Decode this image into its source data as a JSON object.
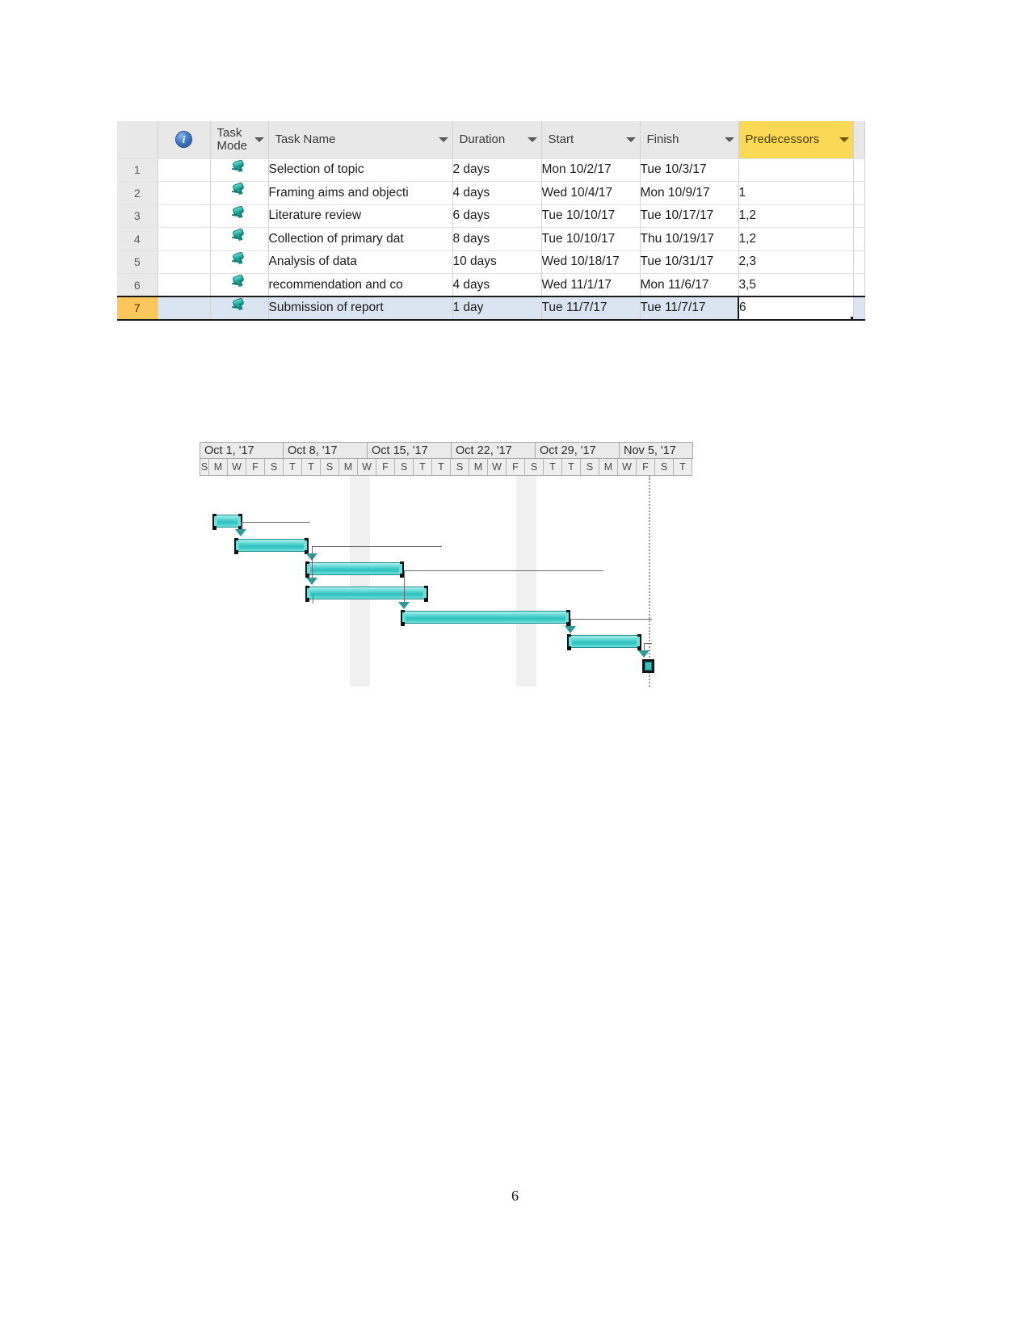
{
  "document": {
    "page_number": "6"
  },
  "task_table": {
    "columns": [
      {
        "key": "rownum",
        "label": "",
        "sortable": false
      },
      {
        "key": "ind",
        "label": "",
        "icon": "info-icon",
        "sortable": false
      },
      {
        "key": "mode",
        "label": "Task Mode",
        "sortable": true
      },
      {
        "key": "name",
        "label": "Task Name",
        "sortable": true
      },
      {
        "key": "dur",
        "label": "Duration",
        "sortable": true
      },
      {
        "key": "start",
        "label": "Start",
        "sortable": true
      },
      {
        "key": "finish",
        "label": "Finish",
        "sortable": true
      },
      {
        "key": "pred",
        "label": "Predecessors",
        "sortable": true,
        "highlight": true
      }
    ],
    "header_labels": {
      "task_mode": "Task Mode",
      "task_name": "Task Name",
      "duration": "Duration",
      "start": "Start",
      "finish": "Finish",
      "predecessors": "Predecessors"
    },
    "rows": [
      {
        "num": "1",
        "mode_icon": "pushpin-icon",
        "name": "Selection of topic",
        "duration": "2 days",
        "start": "Mon 10/2/17",
        "finish": "Tue 10/3/17",
        "predecessors": ""
      },
      {
        "num": "2",
        "mode_icon": "pushpin-icon",
        "name": "Framing aims and objecti",
        "duration": "4 days",
        "start": "Wed 10/4/17",
        "finish": "Mon 10/9/17",
        "predecessors": "1"
      },
      {
        "num": "3",
        "mode_icon": "pushpin-icon",
        "name": "Literature review",
        "duration": "6 days",
        "start": "Tue 10/10/17",
        "finish": "Tue 10/17/17",
        "predecessors": "1,2"
      },
      {
        "num": "4",
        "mode_icon": "pushpin-icon",
        "name": "Collection of primary dat",
        "duration": "8 days",
        "start": "Tue 10/10/17",
        "finish": "Thu 10/19/17",
        "predecessors": "1,2"
      },
      {
        "num": "5",
        "mode_icon": "pushpin-icon",
        "name": "Analysis of data",
        "duration": "10 days",
        "start": "Wed 10/18/17",
        "finish": "Tue 10/31/17",
        "predecessors": "2,3"
      },
      {
        "num": "6",
        "mode_icon": "pushpin-icon",
        "name": "recommendation and co",
        "duration": "4 days",
        "start": "Wed 11/1/17",
        "finish": "Mon 11/6/17",
        "predecessors": "3,5"
      },
      {
        "num": "7",
        "mode_icon": "pushpin-icon",
        "name": "Submission of report",
        "duration": "1 day",
        "start": "Tue 11/7/17",
        "finish": "Tue 11/7/17",
        "predecessors": "6",
        "selected": true,
        "active_cell": "pred"
      }
    ]
  },
  "gantt": {
    "week_headers": [
      "Oct 1, '17",
      "Oct 8, '17",
      "Oct 15, '17",
      "Oct 22, '17",
      "Oct 29, '17",
      "Nov 5, '17"
    ],
    "day_labels": [
      "S",
      "M",
      "W",
      "F",
      "S",
      "T",
      "T",
      "S",
      "M",
      "W",
      "F",
      "S",
      "T",
      "T",
      "S",
      "M",
      "W",
      "F",
      "S",
      "T",
      "T",
      "S",
      "M",
      "W",
      "F",
      "S",
      "T"
    ],
    "colors": {
      "bar_fill": "#3ec9c6",
      "bar_border": "#1f8f8c",
      "link_line": "#6a6a6a",
      "header_bg": "#eaeaea",
      "nonworking_bg": "#f0f0f0"
    },
    "bars": [
      {
        "task": "Selection of topic",
        "row": 1,
        "duration_days": 2,
        "type": "task"
      },
      {
        "task": "Framing aims and objecti",
        "row": 2,
        "duration_days": 4,
        "type": "task"
      },
      {
        "task": "Literature review",
        "row": 3,
        "duration_days": 6,
        "type": "task"
      },
      {
        "task": "Collection of primary dat",
        "row": 4,
        "duration_days": 8,
        "type": "task"
      },
      {
        "task": "Analysis of data",
        "row": 5,
        "duration_days": 10,
        "type": "task"
      },
      {
        "task": "recommendation and co",
        "row": 6,
        "duration_days": 4,
        "type": "task"
      },
      {
        "task": "Submission of report",
        "row": 7,
        "duration_days": 1,
        "type": "milestone"
      }
    ]
  }
}
